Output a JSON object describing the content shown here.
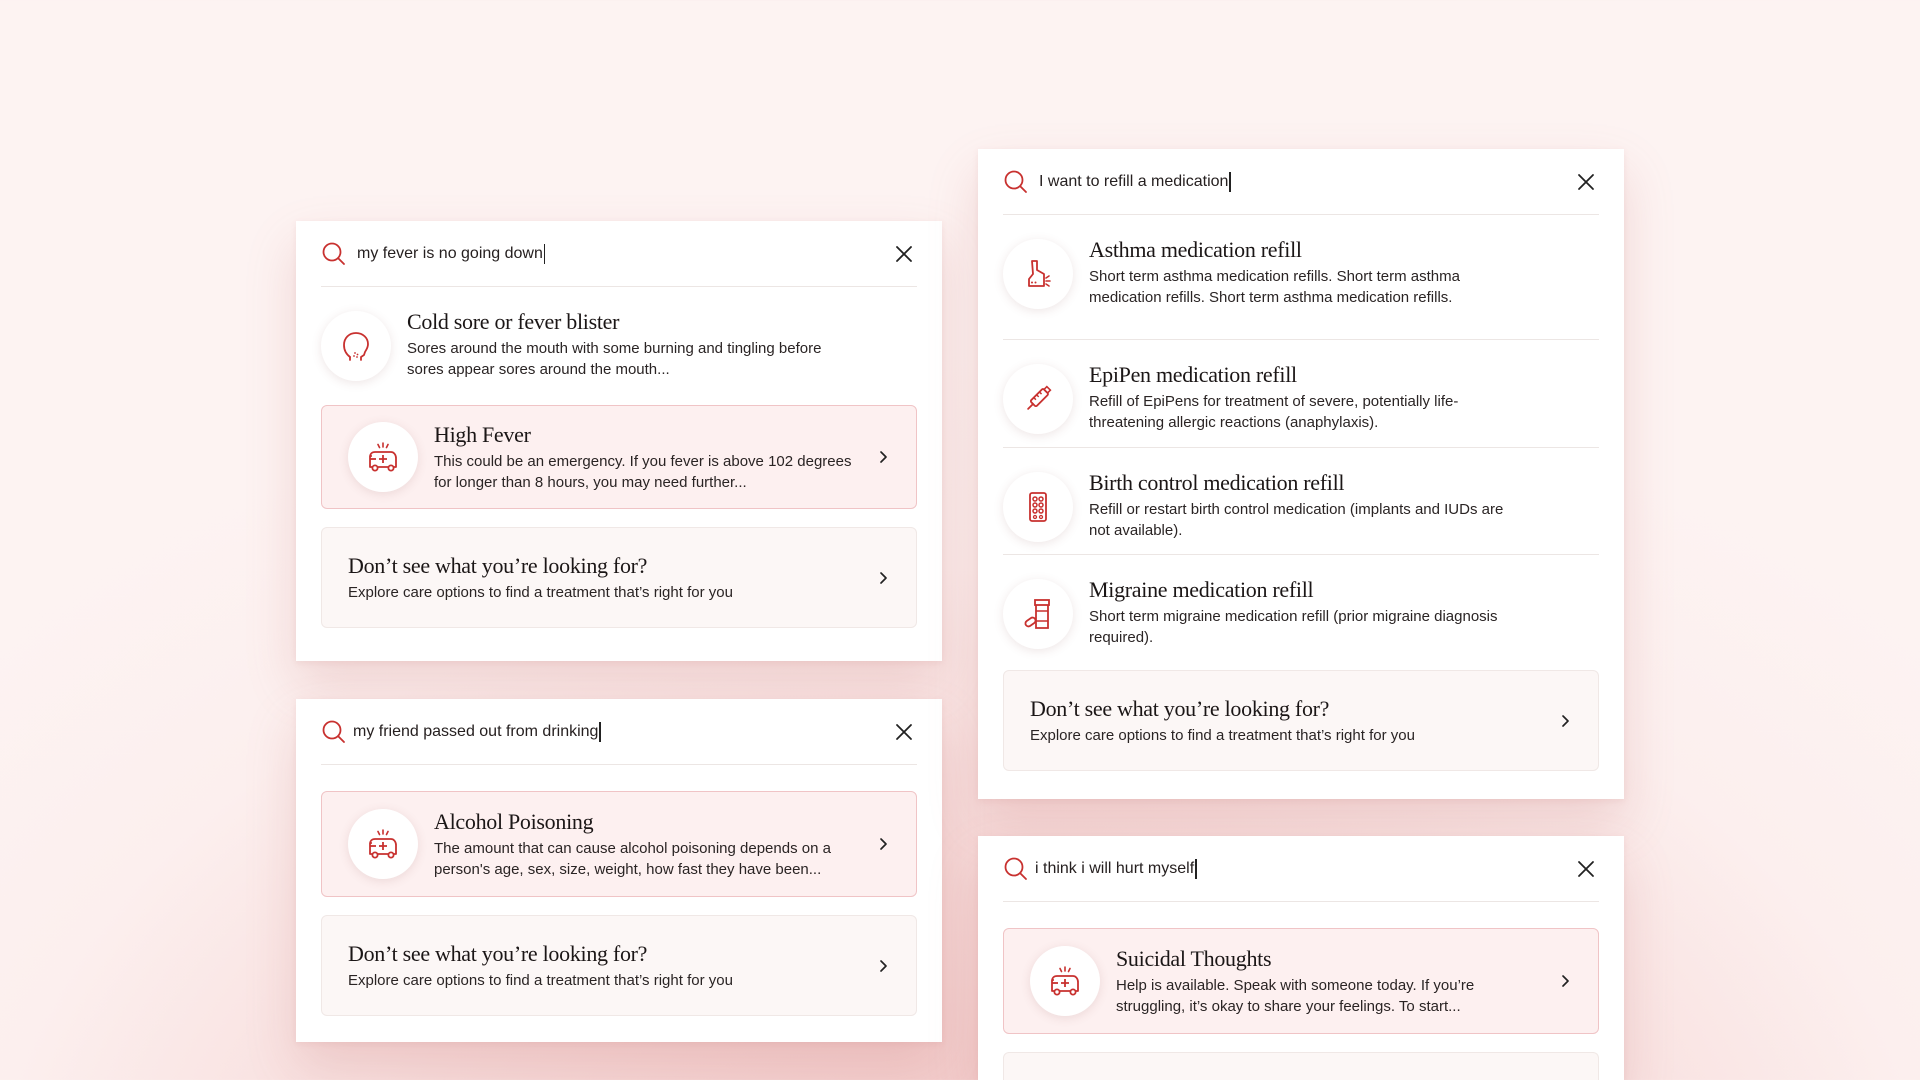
{
  "colors": {
    "accent": "#c8312f",
    "alert_bg": "#fdf0f0",
    "explore_bg": "#fcf7f6"
  },
  "panel_fever": {
    "query": "my fever is no going down",
    "results": [
      {
        "icon": "face-sore-icon",
        "title": "Cold sore or fever blister",
        "desc": "Sores around the mouth with some burning and tingling before sores appear sores around the mouth..."
      }
    ],
    "alert": {
      "icon": "ambulance-icon",
      "title": "High Fever",
      "desc": "This could be an emergency. If you fever is above 102 degrees for longer than 8 hours, you may need further..."
    },
    "explore": {
      "title": "Don’t see what you’re looking for?",
      "desc": "Explore care options to find a treatment that’s right for you"
    }
  },
  "panel_alcohol": {
    "query": "my friend passed out from drinking",
    "alert": {
      "icon": "ambulance-icon",
      "title": "Alcohol Poisoning",
      "desc": "The amount that can cause alcohol poisoning depends on a person's age, sex, size, weight, how fast they have been..."
    },
    "explore": {
      "title": "Don’t see what you’re looking for?",
      "desc": "Explore care options to find a treatment that’s right for you"
    }
  },
  "panel_refill": {
    "query": "I want to refill a medication",
    "results": [
      {
        "icon": "inhaler-icon",
        "title": "Asthma medication refill",
        "desc": "Short term asthma medication refills. Short term asthma medication refills. Short term asthma medication refills."
      },
      {
        "icon": "epipen-icon",
        "title": "EpiPen medication refill",
        "desc": "Refill of EpiPens for treatment of severe, potentially life-threatening allergic reactions (anaphylaxis)."
      },
      {
        "icon": "pill-pack-icon",
        "title": "Birth control medication refill",
        "desc": "Refill or restart birth control medication (implants and IUDs are not available)."
      },
      {
        "icon": "pill-bottle-icon",
        "title": "Migraine medication refill",
        "desc": "Short term migraine medication refill (prior migraine diagnosis required)."
      }
    ],
    "explore": {
      "title": "Don’t see what you’re looking for?",
      "desc": "Explore care options to find a treatment that’s right for you"
    }
  },
  "panel_hurt": {
    "query": "i think i will hurt myself",
    "alert": {
      "icon": "ambulance-icon",
      "title": "Suicidal Thoughts",
      "desc": "Help is available. Speak with someone today. If you’re struggling, it’s okay to share your feelings. To start..."
    }
  }
}
